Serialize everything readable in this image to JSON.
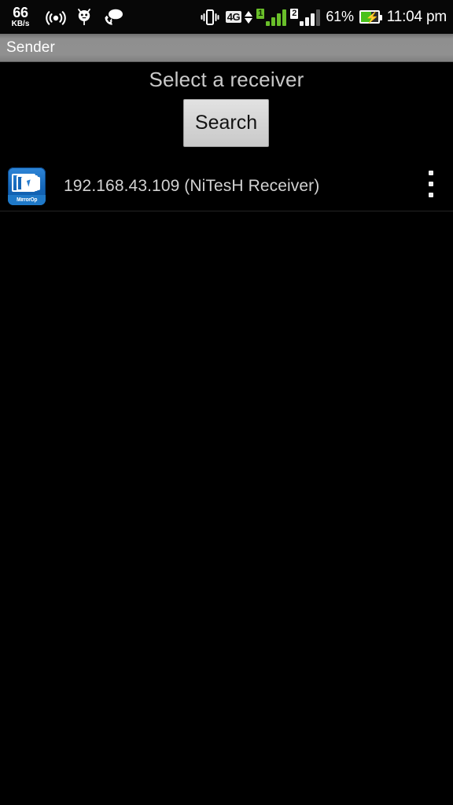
{
  "status_bar": {
    "network_speed_value": "66",
    "network_speed_unit": "KB/s",
    "hotspot_icon": "hotspot-icon",
    "robot_icon": "android-robot-icon",
    "call_bubble_icon": "call-message-icon",
    "vibrate_icon": "vibrate-icon",
    "network_type": "4G",
    "data_arrows_icon": "data-transfer-arrows-icon",
    "sim1_label": "1",
    "sim2_label": "2",
    "sim1_signal_bars": 4,
    "sim2_signal_bars": 3,
    "battery_percent_text": "61%",
    "battery_level": 61,
    "battery_charging": true,
    "charging_bolt_icon": "lightning-bolt-icon",
    "clock": "11:04 pm",
    "colors": {
      "background": "#070707",
      "sim1_accent": "#6abf2a",
      "battery_green": "#49c11b",
      "text": "#ffffff"
    }
  },
  "title_bar": {
    "title": "Sender",
    "background": "#8f8f8f",
    "text_color": "#ffffff"
  },
  "main": {
    "heading": "Select a receiver",
    "search_button_label": "Search",
    "overflow_menu_name": "more-options",
    "devices": [
      {
        "icon_name": "mirrorop-app-icon",
        "icon_label": "MirrorOp",
        "label": "192.168.43.109 (NiTesH Receiver)"
      }
    ],
    "colors": {
      "background": "#000000",
      "heading_text": "#c9c9c9",
      "device_text": "#d2d2d2",
      "button_face": "#d6d6d6",
      "button_text": "#131313",
      "icon_blue": "#1466b8",
      "divider": "#232323"
    }
  }
}
